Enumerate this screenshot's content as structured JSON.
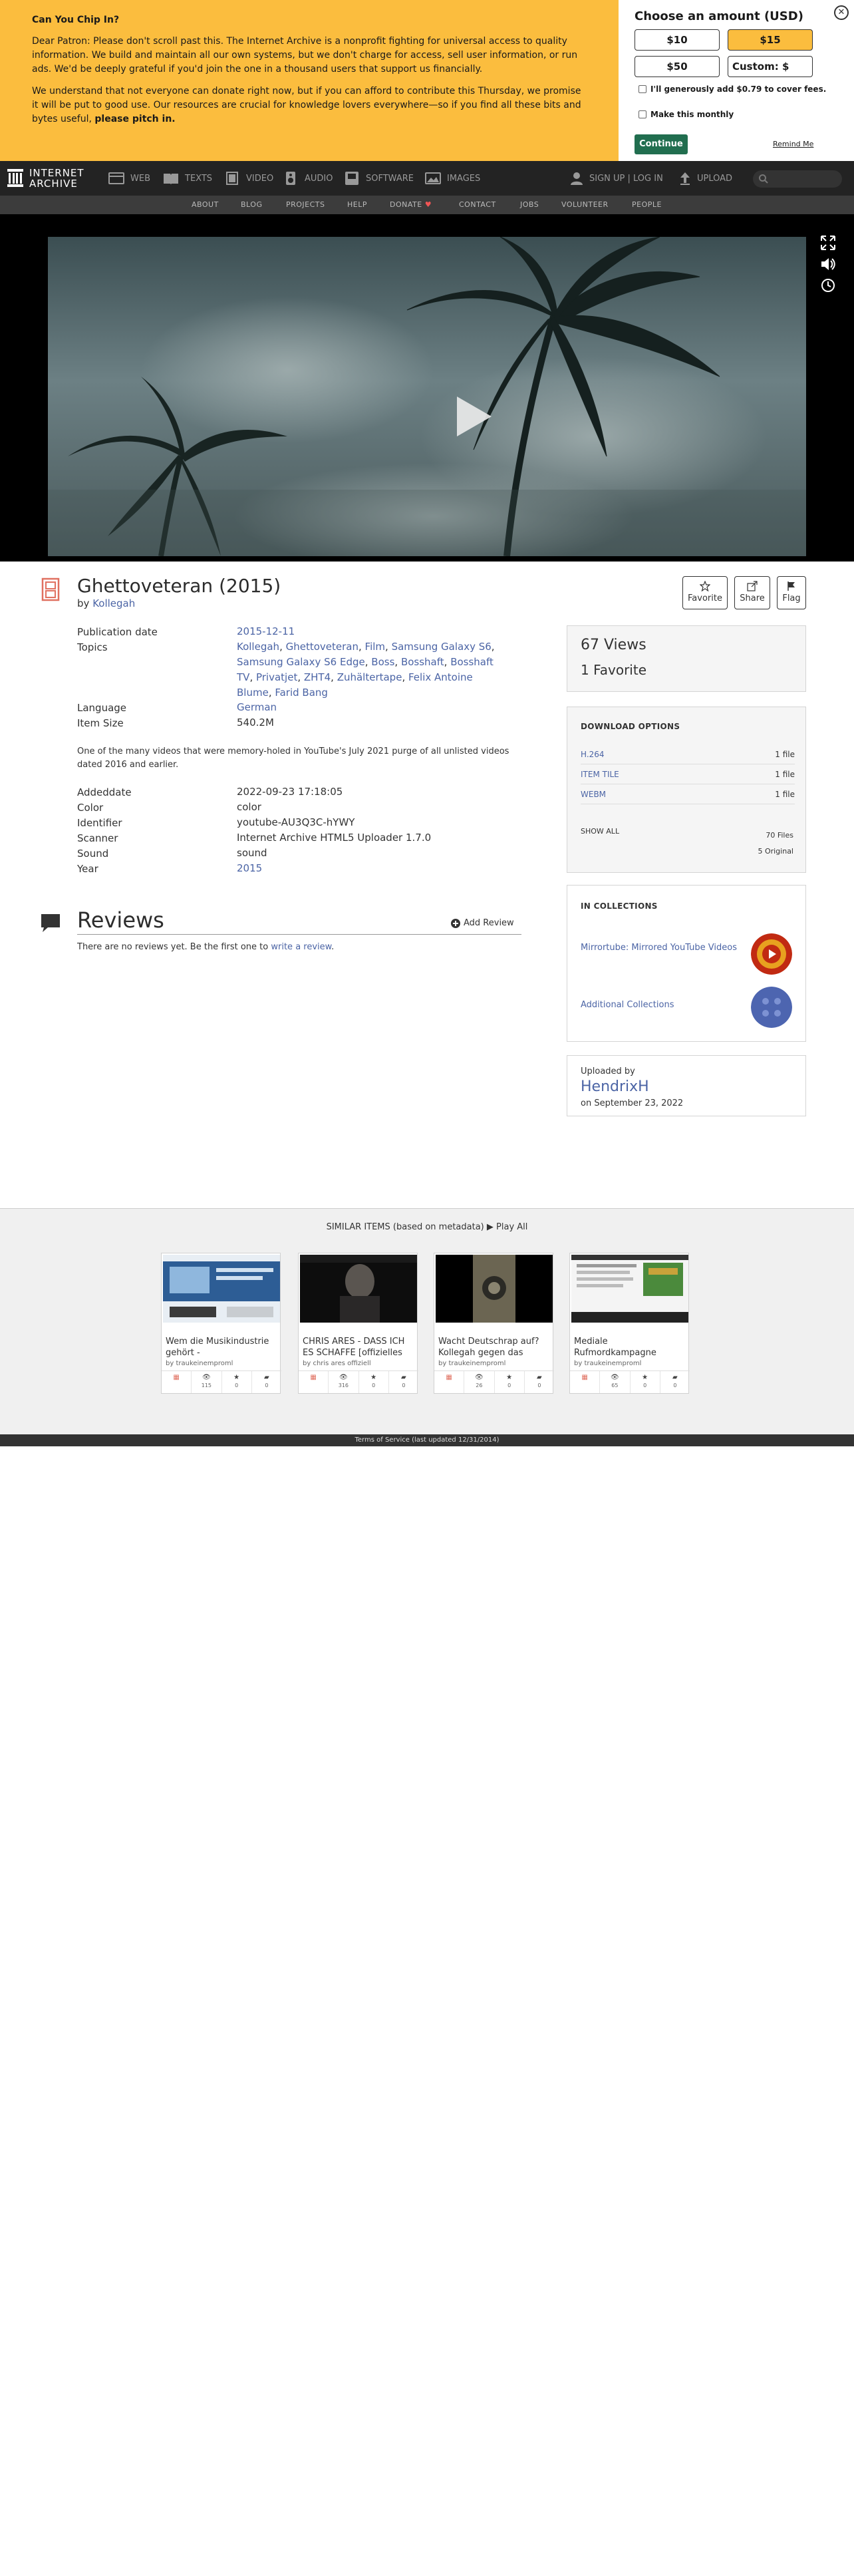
{
  "donate": {
    "heading": "Can You Chip In?",
    "para1": "Dear Patron: Please don't scroll past this. The Internet Archive is a nonprofit fighting for universal access to quality information. We build and maintain all our own systems, but we don't charge for access, sell user information, or run ads. We'd be deeply grateful if you'd join the one in a thousand users that support us financially.",
    "para2_main": "We understand that not everyone can donate right now, but if you can afford to contribute this Thursday, we promise it will be put to good use. Our resources are crucial for knowledge lovers everywhere—so if you find all these bits and bytes useful,",
    "para2_bold": "please pitch in.",
    "amount_title": "Choose an amount (USD)",
    "amounts": [
      "$10",
      "$15",
      "$50"
    ],
    "selected_amount": "$15",
    "custom_label": "Custom: $",
    "fee_label": "I'll generously add $0.79 to cover fees.",
    "monthly_label": "Make this monthly",
    "continue_label": "Continue",
    "remind_label": "Remind Me",
    "close_label": "✕"
  },
  "topnav": {
    "logo_line1": "INTERNET",
    "logo_line2": "ARCHIVE",
    "items": [
      {
        "label": "WEB",
        "icon": "web-icon"
      },
      {
        "label": "TEXTS",
        "icon": "texts-icon"
      },
      {
        "label": "VIDEO",
        "icon": "video-icon"
      },
      {
        "label": "AUDIO",
        "icon": "audio-icon"
      },
      {
        "label": "SOFTWARE",
        "icon": "software-icon"
      },
      {
        "label": "IMAGES",
        "icon": "images-icon"
      }
    ],
    "signin": "SIGN UP | LOG IN",
    "upload": "UPLOAD"
  },
  "subnav": {
    "items": [
      "ABOUT",
      "BLOG",
      "PROJECTS",
      "HELP",
      "DONATE",
      "CONTACT",
      "JOBS",
      "VOLUNTEER",
      "PEOPLE"
    ]
  },
  "item": {
    "title": "Ghettoveteran (2015)",
    "by_label": "by",
    "creator": "Kollegah",
    "actions": {
      "favorite": "Favorite",
      "share": "Share",
      "flag": "Flag"
    },
    "metadata": {
      "pubdate_label": "Publication date",
      "pubdate": "2015-12-11",
      "topics_label": "Topics",
      "topics": [
        "Kollegah",
        "Ghettoveteran",
        "Film",
        "Samsung Galaxy S6",
        "Samsung Galaxy S6 Edge",
        "Boss",
        "Bosshaft",
        "Bosshaft TV",
        "Privatjet",
        "ZHT4",
        "Zuhältertape",
        "Felix Antoine Blume",
        "Farid Bang"
      ],
      "language_label": "Language",
      "language": "German",
      "itemsize_label": "Item Size",
      "itemsize": "540.2M"
    },
    "description": "One of the many videos that were memory-holed in YouTube's July 2021 purge of all unlisted videos dated 2016 and earlier.",
    "details": {
      "addeddate_label": "Addeddate",
      "addeddate": "2022-09-23 17:18:05",
      "color_label": "Color",
      "color": "color",
      "identifier_label": "Identifier",
      "identifier": "youtube-AU3Q3C-hYWY",
      "scanner_label": "Scanner",
      "scanner": "Internet Archive HTML5 Uploader 1.7.0",
      "sound_label": "Sound",
      "sound": "sound",
      "year_label": "Year",
      "year": "2015"
    }
  },
  "reviews": {
    "title": "Reviews",
    "add_label": "Add Review",
    "empty_text": "There are no reviews yet. Be the first one to",
    "write_link": "write a review",
    "period": "."
  },
  "stats": {
    "views": "67 Views",
    "favorites": "1 Favorite"
  },
  "downloads": {
    "title": "DOWNLOAD OPTIONS",
    "rows": [
      {
        "format": "H.264",
        "count": "1 file"
      },
      {
        "format": "ITEM TILE",
        "count": "1 file"
      },
      {
        "format": "WEBM",
        "count": "1 file"
      }
    ],
    "show_all": "SHOW ALL",
    "total_files": "70 Files",
    "original": "5 Original"
  },
  "collections": {
    "title": "IN COLLECTIONS",
    "items": [
      {
        "name": "Mirrortube: Mirrored YouTube Videos"
      },
      {
        "name": "Additional Collections"
      }
    ]
  },
  "uploader": {
    "label": "Uploaded by",
    "name": "HendrixH",
    "date": "on September 23, 2022"
  },
  "similar": {
    "title": "SIMILAR ITEMS (based on metadata)",
    "play_all": "Play All",
    "cards": [
      {
        "title": "Wem die Musikindustrie gehört -",
        "by": "by traukeinemproml",
        "views": "115",
        "favs": "0",
        "reviews": "0"
      },
      {
        "title": "CHRIS ARES - DASS ICH ES SCHAFFE [offizielles",
        "by": "by chris ares offiziell",
        "views": "316",
        "favs": "0",
        "reviews": "0"
      },
      {
        "title": "Wacht Deutschrap auf? Kollegah gegen das",
        "by": "by traukeinemproml",
        "views": "26",
        "favs": "0",
        "reviews": "0"
      },
      {
        "title": "Mediale Rufmordkampagne",
        "by": "by traukeinemproml",
        "views": "65",
        "favs": "0",
        "reviews": "0"
      }
    ]
  },
  "footer": {
    "text": "Terms of Service (last updated 12/31/2014)"
  },
  "colors": {
    "banner": "#fbbd3e",
    "link": "#4b64a5",
    "nav_bg": "#232323",
    "continue": "#216e4f"
  }
}
